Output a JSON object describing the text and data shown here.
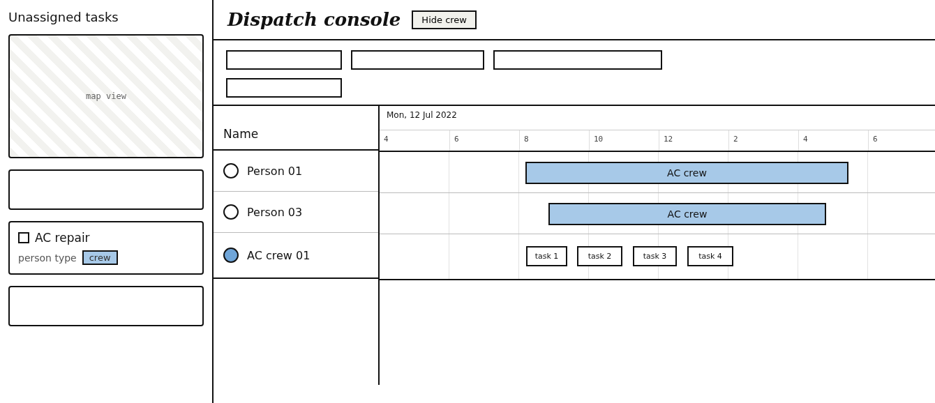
{
  "sidebar": {
    "title": "Unassigned tasks",
    "map_label": "map view",
    "tasks": [
      {
        "kind": "empty"
      },
      {
        "kind": "task",
        "title": "AC repair",
        "checked": false,
        "field_label": "person type",
        "tag": "crew"
      },
      {
        "kind": "empty"
      }
    ]
  },
  "header": {
    "title": "Dispatch console",
    "button": "Hide crew"
  },
  "schedule": {
    "name_header": "Name",
    "date": "Mon, 12 Jul 2022",
    "ticks": [
      "4",
      "6",
      "8",
      "10",
      "12",
      "2",
      "4",
      "6"
    ],
    "rows": [
      {
        "name": "Person 01",
        "selected": false,
        "events": [
          {
            "kind": "shift",
            "label": "AC crew"
          }
        ]
      },
      {
        "name": "Person 03",
        "selected": false,
        "events": [
          {
            "kind": "shift",
            "label": "AC crew"
          }
        ]
      },
      {
        "name": "AC crew 01",
        "selected": true,
        "events": [
          {
            "kind": "task",
            "label": "task 1"
          },
          {
            "kind": "task",
            "label": "task 2"
          },
          {
            "kind": "task",
            "label": "task 3"
          },
          {
            "kind": "task",
            "label": "task 4"
          }
        ]
      }
    ]
  }
}
